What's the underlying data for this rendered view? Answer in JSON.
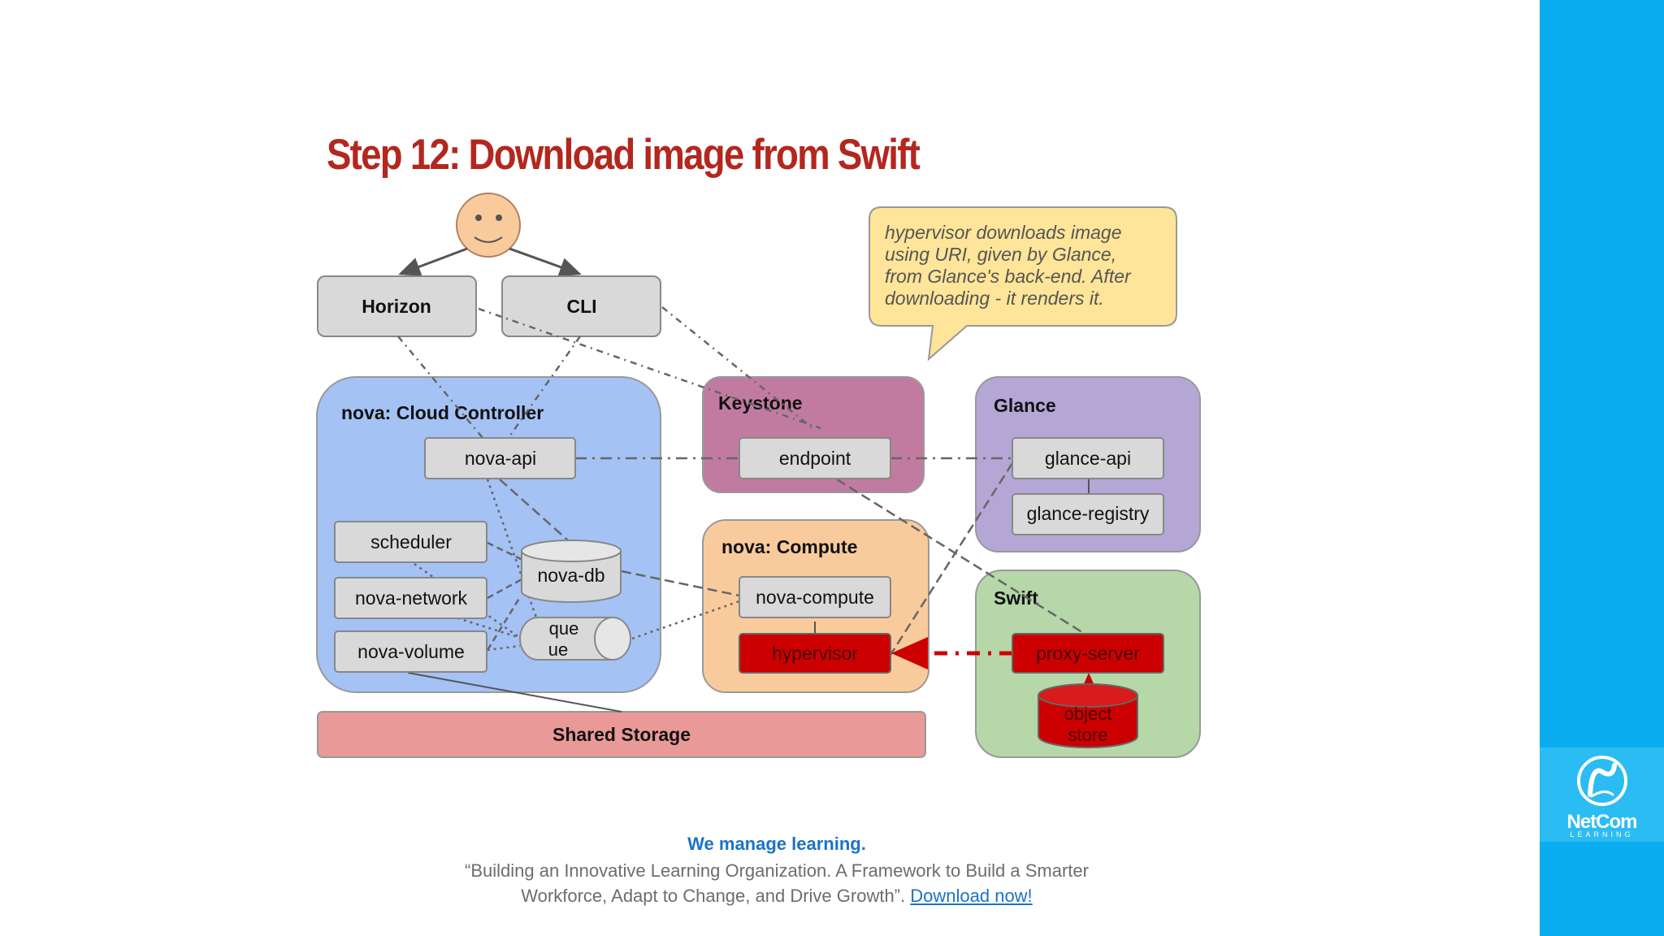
{
  "slide": {
    "title": "Step 12: Download image from Swift"
  },
  "callout": {
    "lines": [
      "hypervisor downloads image",
      "using URI, given by Glance,",
      "from Glance's back-end. After",
      "downloading - it renders it."
    ]
  },
  "diagram": {
    "horizon": "Horizon",
    "cli": "CLI",
    "cloud_controller": {
      "title": "nova: Cloud Controller",
      "nova_api": "nova-api",
      "scheduler": "scheduler",
      "nova_network": "nova-network",
      "nova_volume": "nova-volume",
      "nova_db": "nova-db",
      "queue_line1": "que",
      "queue_line2": "ue"
    },
    "keystone": {
      "title": "Keystone",
      "endpoint": "endpoint"
    },
    "glance": {
      "title": "Glance",
      "glance_api": "glance-api",
      "glance_registry": "glance-registry"
    },
    "compute": {
      "title": "nova: Compute",
      "nova_compute": "nova-compute",
      "hypervisor": "hypervisor"
    },
    "swift": {
      "title": "Swift",
      "proxy_server": "proxy-server",
      "object_store_line1": "object",
      "object_store_line2": "store"
    },
    "shared_storage": "Shared Storage"
  },
  "footer": {
    "tagline": "We manage learning.",
    "quote_line1": "“Building an Innovative Learning Organization. A Framework to Build a Smarter",
    "quote_line2": "Workforce, Adapt to Change, and Drive Growth”.",
    "download_link": "Download now!"
  },
  "brand": {
    "logo_name": "NetCom",
    "logo_sub": "LEARNING",
    "logo_icon": "netcom-swirl-icon",
    "sidebar_color": "#0aaef0"
  },
  "colors": {
    "title": "#b3271f",
    "cloud_controller": "#a4c2f4",
    "keystone": "#c27ba0",
    "glance": "#b4a7d6",
    "compute": "#f9cb9c",
    "swift": "#b6d7a8",
    "shared_storage": "#ea9999",
    "highlight": "#cc0000",
    "callout": "#ffe599"
  }
}
